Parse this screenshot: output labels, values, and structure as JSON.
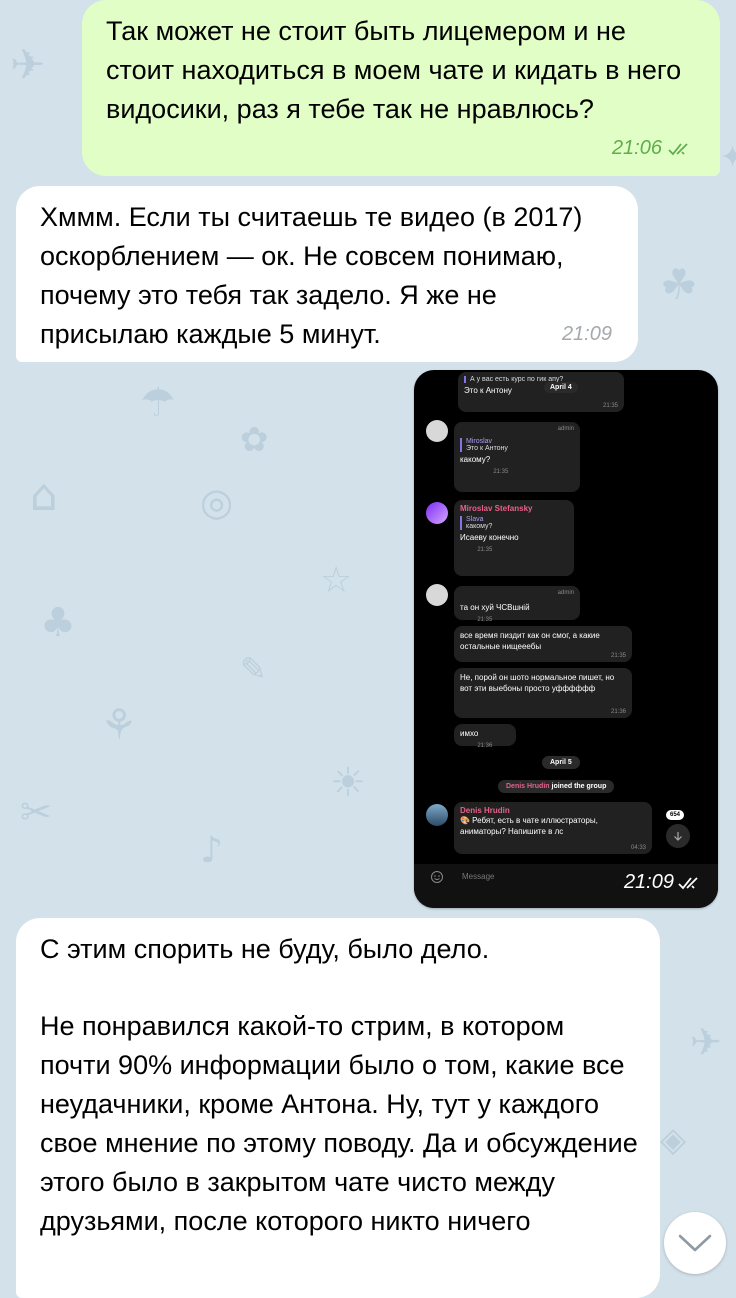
{
  "messages": {
    "m1": {
      "text": "Так может не стоит быть лицемером и не стоит находиться в моем чате и кидать в него видосики, раз я тебе так не нравлюсь?",
      "time": "21:06"
    },
    "m2": {
      "text": "Хммм. Если ты считаешь те видео (в 2017) оскорблением — ок. Не совсем понимаю, почему это тебя так задело. Я же не присылаю каждые 5 минут.",
      "time": "21:09"
    },
    "m3": {
      "time": "21:09"
    },
    "m4": {
      "p1": "С этим спорить не буду, было дело.",
      "p2": "Не понравился какой-то стрим, в котором почти 90% информации было о том, какие все неудачники, кроме Антона. Ну, тут у каждого свое мнение по этому поводу. Да и обсуждение этого было в закрытом чате чисто между друзьями, после которого никто ничего"
    }
  },
  "screenshot": {
    "b1": {
      "t1": "А у вас есть курс по гик апу?",
      "t2": "Это к Антону",
      "time": "21:35"
    },
    "date1": "April 4",
    "b2": {
      "admin": "admin",
      "qname": "Miroslav",
      "qtext": "Это к Антону",
      "text": "какому?",
      "time": "21:35"
    },
    "b3": {
      "sender": "Miroslav Stefansky",
      "qname": "Slava",
      "qtext": "какому?",
      "text": "Исаеву конечно",
      "time": "21:35"
    },
    "b4": {
      "admin": "admin",
      "text": "та он хуй ЧСВшній",
      "time": "21:35"
    },
    "b5": {
      "text": "все время пиздит как он смог, а какие остальные нищееебы",
      "time": "21:35"
    },
    "b6": {
      "text": "Не, порой он шото нормальное пишет, но вот эти выебоны просто уфффффф",
      "time": "21:36"
    },
    "b7": {
      "text": "имхо",
      "time": "21:36"
    },
    "date2": "April 5",
    "joined": {
      "name": "Denis Hrudin",
      "action": "joined the group"
    },
    "b8": {
      "sender": "Denis Hrudin",
      "text": "🎨 Ребят, есть в чате иллюстраторы, аниматоры? Напишите в лс",
      "time": "04:33"
    },
    "unread": "654",
    "composer_placeholder": "Message"
  },
  "colors": {
    "outgoing_bubble": "#e1fec6",
    "incoming_bubble": "#ffffff",
    "check_green": "#5fad4e",
    "wallpaper": "#d3e1ea",
    "screenshot_sender": "#e8608a",
    "highlight_scribble": "#ff2bc2"
  },
  "icons": [
    "double-check-icon",
    "emoji-icon",
    "chevron-down-icon",
    "arrow-down-icon"
  ]
}
